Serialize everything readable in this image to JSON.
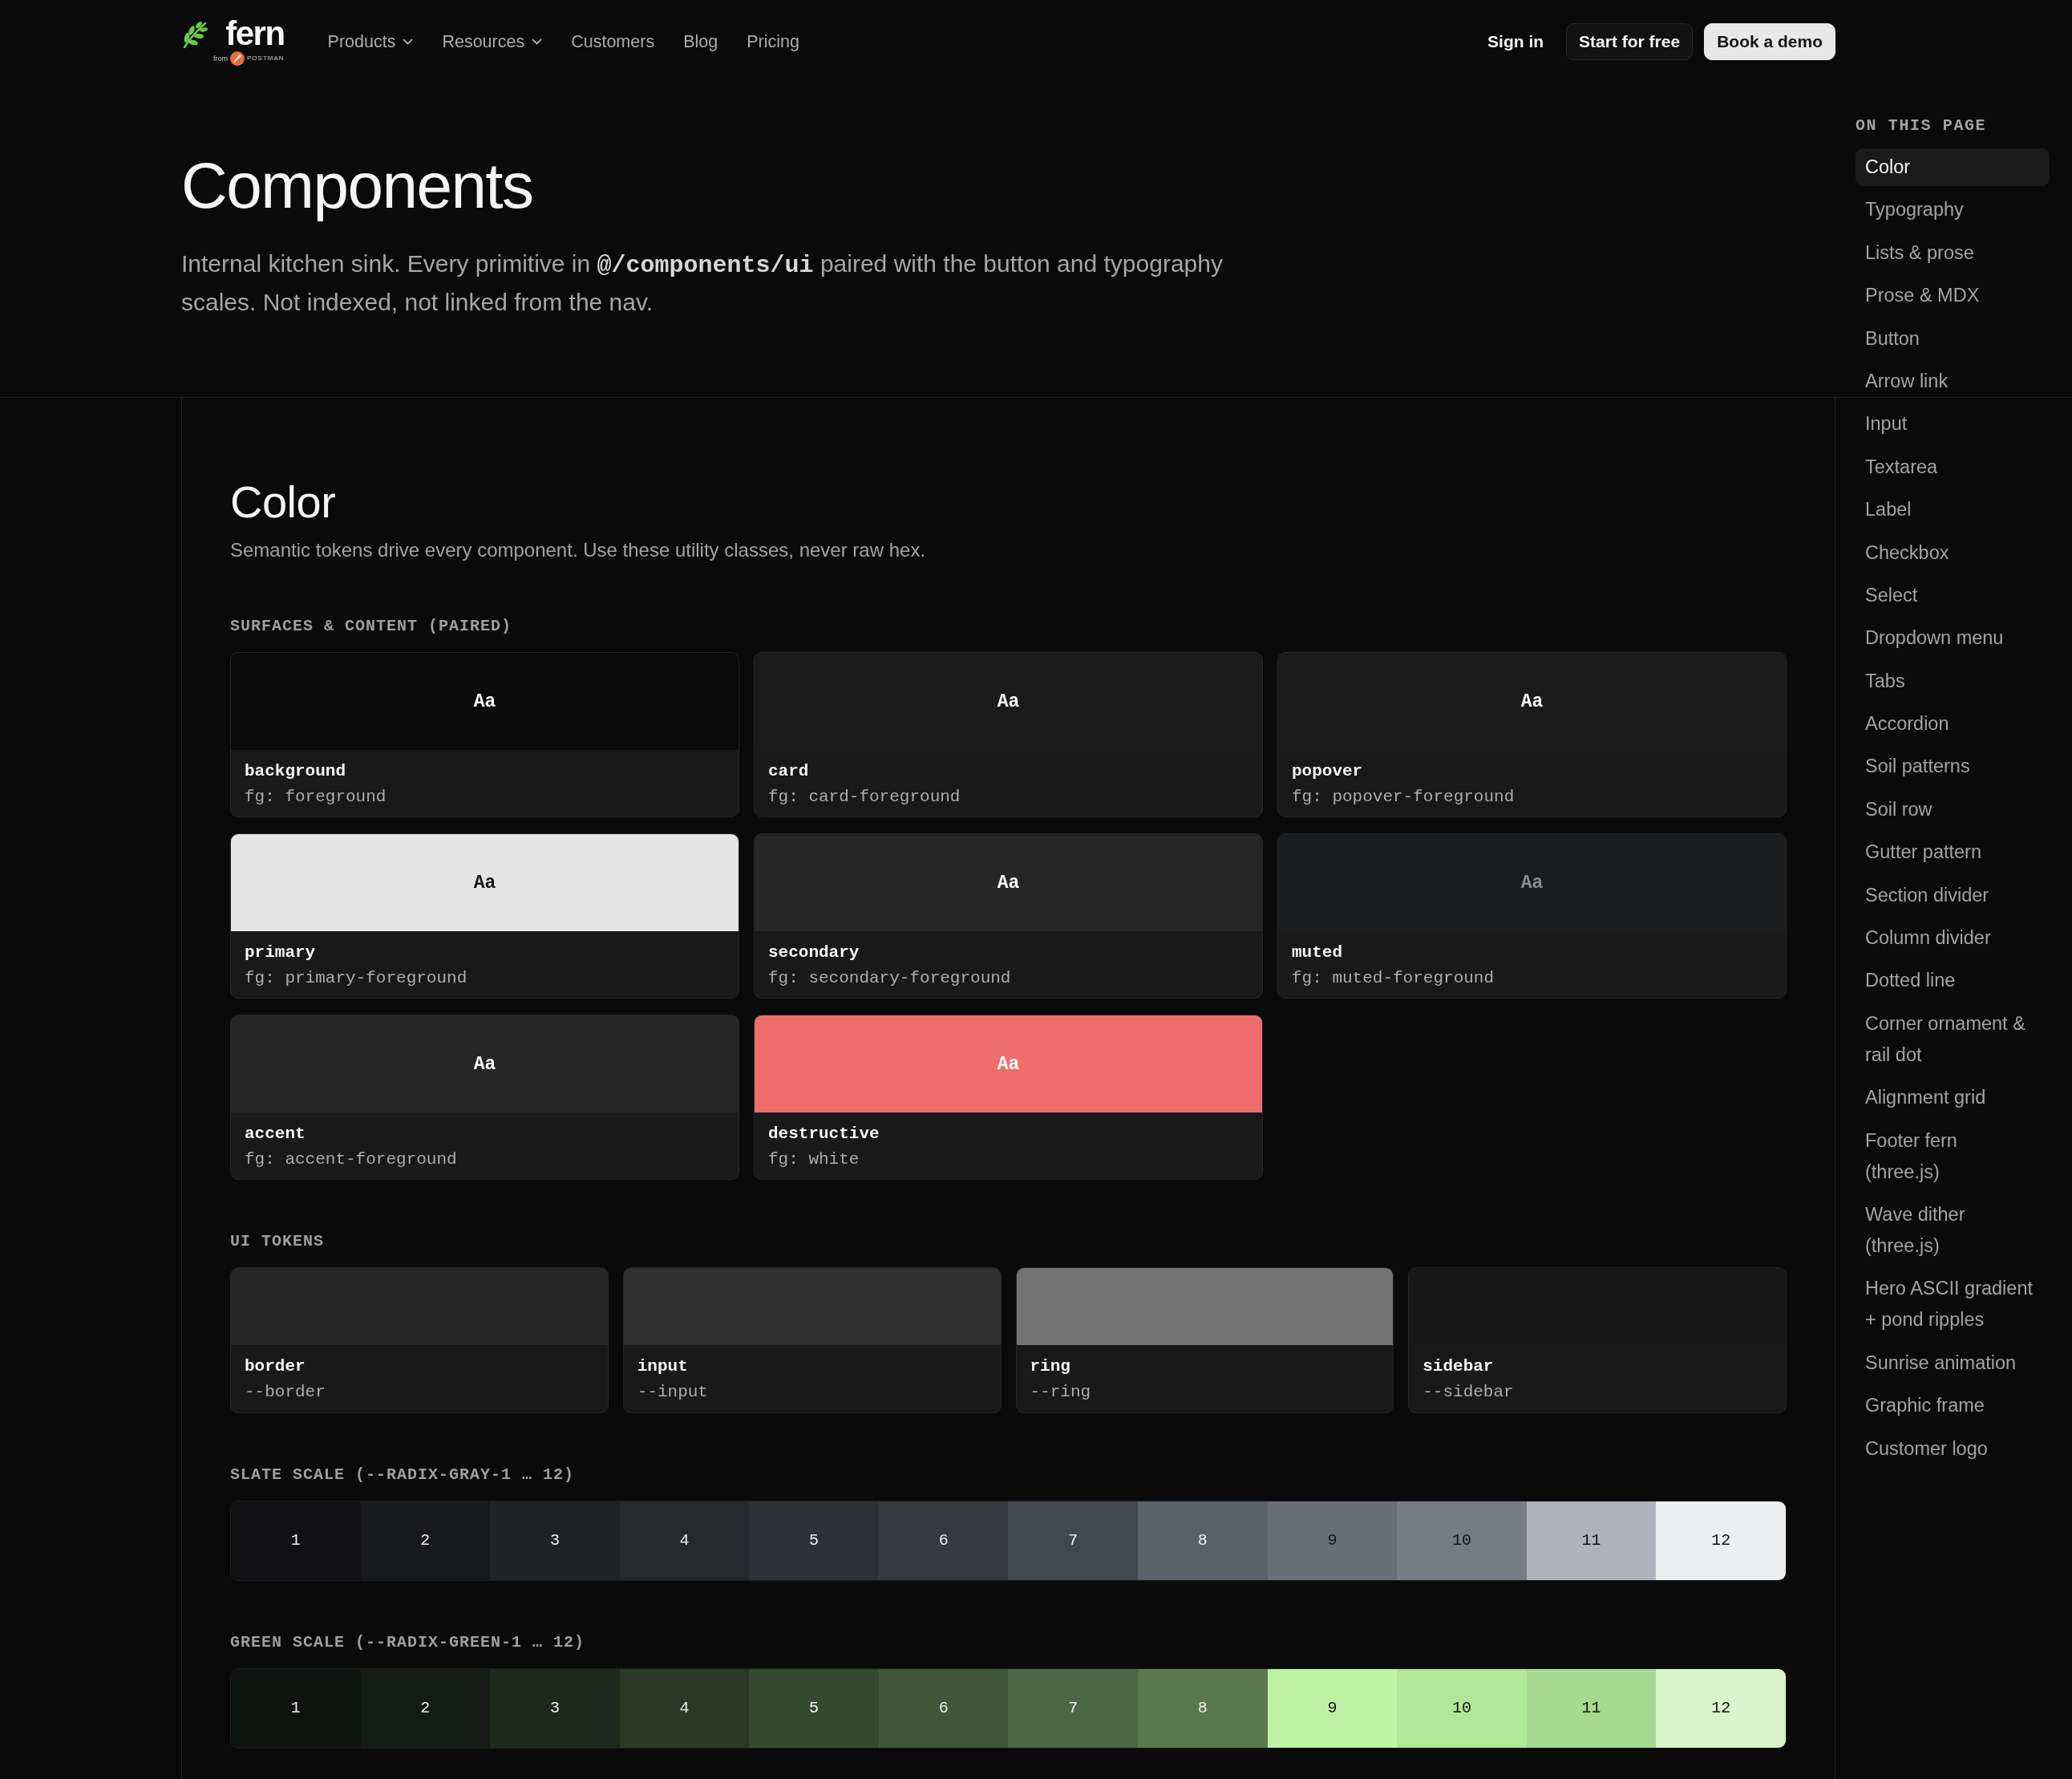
{
  "header": {
    "logo": {
      "wordmark": "fern",
      "from": "from",
      "partner": "POSTMAN"
    },
    "nav": [
      {
        "label": "Products",
        "has_menu": true
      },
      {
        "label": "Resources",
        "has_menu": true
      },
      {
        "label": "Customers",
        "has_menu": false
      },
      {
        "label": "Blog",
        "has_menu": false
      },
      {
        "label": "Pricing",
        "has_menu": false
      }
    ],
    "actions": [
      {
        "label": "Sign in",
        "kind": "link"
      },
      {
        "label": "Start for free",
        "kind": "outline"
      },
      {
        "label": "Book a demo",
        "kind": "solid"
      }
    ]
  },
  "hero": {
    "title": "Components",
    "description": "Internal kitchen sink. Every primitive in **@/components/ui** paired with the button and typography scales. Not indexed, not linked from the nav."
  },
  "section": {
    "title": "Color",
    "subtitle": "Semantic tokens drive every component. Use these utility classes, never raw hex.",
    "surfaces": {
      "label": "SURFACES & CONTENT (PAIRED)",
      "cards": [
        {
          "sample": "Aa",
          "name": "background",
          "detail": "fg: foreground",
          "color": "#0a0a0a",
          "kind": "standard"
        },
        {
          "sample": "Aa",
          "name": "card",
          "detail": "fg: card-foreground",
          "color": "#1a1a1a",
          "kind": "standard"
        },
        {
          "sample": "Aa",
          "name": "popover",
          "detail": "fg: popover-foreground",
          "color": "#1a1a1a",
          "kind": "standard"
        },
        {
          "sample": "Aa",
          "name": "primary",
          "detail": "fg: primary-foreground",
          "color": "#e5e5e5",
          "kind": "inverse"
        },
        {
          "sample": "Aa",
          "name": "secondary",
          "detail": "fg: secondary-foreground",
          "color": "#262626",
          "kind": "standard"
        },
        {
          "sample": "Aa",
          "name": "muted",
          "detail": "fg: muted-foreground",
          "color": "#1b1c1e",
          "kind": "muted"
        },
        {
          "sample": "Aa",
          "name": "accent",
          "detail": "fg: accent-foreground",
          "color": "#262626",
          "kind": "standard"
        },
        {
          "sample": "Aa",
          "name": "destructive",
          "detail": "fg: white",
          "color": "#ee6e6e",
          "kind": "standard"
        }
      ]
    },
    "ui_tokens": {
      "label": "UI TOKENS",
      "cards": [
        {
          "name": "border",
          "detail": "--border",
          "color": "#262626"
        },
        {
          "name": "input",
          "detail": "--input",
          "color": "#303030"
        },
        {
          "name": "ring",
          "detail": "--ring",
          "color": "#737373"
        },
        {
          "name": "sidebar",
          "detail": "--sidebar",
          "color": "#171717"
        }
      ]
    },
    "scales": [
      {
        "label": "SLATE SCALE (--RADIX-GRAY-1 … 12)",
        "cells": [
          {
            "label": "1",
            "color": "#111113",
            "kind": "dark"
          },
          {
            "label": "2",
            "color": "#18191b",
            "kind": "dark"
          },
          {
            "label": "3",
            "color": "#212225",
            "kind": "dark"
          },
          {
            "label": "4",
            "color": "#272a2d",
            "kind": "dark"
          },
          {
            "label": "5",
            "color": "#2e3135",
            "kind": "dark"
          },
          {
            "label": "6",
            "color": "#363a3f",
            "kind": "dark"
          },
          {
            "label": "7",
            "color": "#43484e",
            "kind": "dark"
          },
          {
            "label": "8",
            "color": "#5a6169",
            "kind": "dark"
          },
          {
            "label": "9",
            "color": "#696e77",
            "kind": "light"
          },
          {
            "label": "10",
            "color": "#777b84",
            "kind": "light"
          },
          {
            "label": "11",
            "color": "#b0b4ba",
            "kind": "light"
          },
          {
            "label": "12",
            "color": "#edeef0",
            "kind": "light"
          }
        ]
      },
      {
        "label": "GREEN SCALE (--RADIX-GREEN-1 … 12)",
        "cells": [
          {
            "label": "1",
            "color": "#0f130f",
            "kind": "dark"
          },
          {
            "label": "2",
            "color": "#141a14",
            "kind": "dark"
          },
          {
            "label": "3",
            "color": "#1e2a1e",
            "kind": "dark"
          },
          {
            "label": "4",
            "color": "#2a3a27",
            "kind": "dark"
          },
          {
            "label": "5",
            "color": "#354930",
            "kind": "dark"
          },
          {
            "label": "6",
            "color": "#40553a",
            "kind": "dark"
          },
          {
            "label": "7",
            "color": "#4a6644",
            "kind": "dark"
          },
          {
            "label": "8",
            "color": "#5a784d",
            "kind": "dark"
          },
          {
            "label": "9",
            "color": "#bff2a3",
            "kind": "light"
          },
          {
            "label": "10",
            "color": "#b1e799",
            "kind": "light"
          },
          {
            "label": "11",
            "color": "#a7da90",
            "kind": "light"
          },
          {
            "label": "12",
            "color": "#daf4cb",
            "kind": "light"
          }
        ]
      }
    ]
  },
  "toc": {
    "title": "ON THIS PAGE",
    "items": [
      {
        "label": "Color",
        "selected": true
      },
      {
        "label": "Typography",
        "selected": false
      },
      {
        "label": "Lists & prose",
        "selected": false
      },
      {
        "label": "Prose & MDX",
        "selected": false
      },
      {
        "label": "Button",
        "selected": false
      },
      {
        "label": "Arrow link",
        "selected": false
      },
      {
        "label": "Input",
        "selected": false
      },
      {
        "label": "Textarea",
        "selected": false
      },
      {
        "label": "Label",
        "selected": false
      },
      {
        "label": "Checkbox",
        "selected": false
      },
      {
        "label": "Select",
        "selected": false
      },
      {
        "label": "Dropdown menu",
        "selected": false
      },
      {
        "label": "Tabs",
        "selected": false
      },
      {
        "label": "Accordion",
        "selected": false
      },
      {
        "label": "Soil patterns",
        "selected": false
      },
      {
        "label": "Soil row",
        "selected": false
      },
      {
        "label": "Gutter pattern",
        "selected": false
      },
      {
        "label": "Section divider",
        "selected": false
      },
      {
        "label": "Column divider",
        "selected": false
      },
      {
        "label": "Dotted line",
        "selected": false
      },
      {
        "label": "Corner ornament & rail dot",
        "selected": false
      },
      {
        "label": "Alignment grid",
        "selected": false
      },
      {
        "label": "Footer fern (three.js)",
        "selected": false
      },
      {
        "label": "Wave dither (three.js)",
        "selected": false
      },
      {
        "label": "Hero ASCII gradient + pond ripples",
        "selected": false
      },
      {
        "label": "Sunrise animation",
        "selected": false
      },
      {
        "label": "Graphic frame",
        "selected": false
      },
      {
        "label": "Customer logo",
        "selected": false
      }
    ]
  }
}
